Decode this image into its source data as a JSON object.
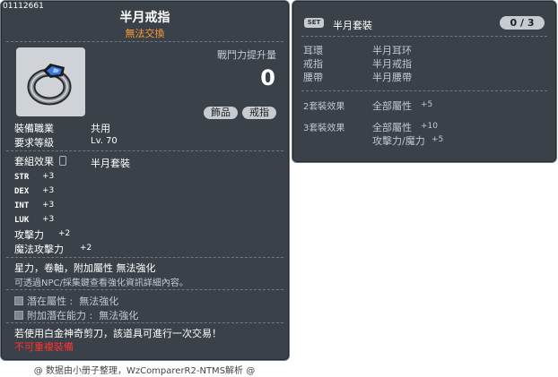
{
  "item_id": "01112661",
  "item": {
    "name": "半月戒指",
    "trade_note": "無法交換",
    "power_label": "戰鬥力提升量",
    "power_value": "0",
    "tags": [
      "飾品",
      "戒指"
    ]
  },
  "requirements": {
    "job_label": "裝備職業",
    "job_value": "共用",
    "level_label": "要求等級",
    "level_value": "Lv. 70"
  },
  "set_effect": {
    "label": "套組效果",
    "name": "半月套裝"
  },
  "stats": [
    {
      "key": "STR",
      "value": "+3"
    },
    {
      "key": "DEX",
      "value": "+3"
    },
    {
      "key": "INT",
      "value": "+3"
    },
    {
      "key": "LUK",
      "value": "+3"
    },
    {
      "key": "攻擊力",
      "value": "+2"
    },
    {
      "key": "魔法攻擊力",
      "value": "+2"
    }
  ],
  "notes": {
    "restrictions": "星力，卷軸，附加屬性 無法強化",
    "npc_hint": "可透過NPC/採集鍵查看強化資訊詳細內容。"
  },
  "potential": {
    "potential_label": "潛在屬性",
    "potential_value": "無法強化",
    "bonus_label": "附加潛在能力",
    "bonus_value": "無法強化"
  },
  "scissors_note": "若使用白金神奇剪刀，該道具可進行一次交易！",
  "unique_note": "不可重複裝備",
  "footer": "@ 数据由小册子整理，WzComparerR2-NTMS解析 @",
  "set_panel": {
    "badge": "SET",
    "title": "半月套裝",
    "count": "0 / 3",
    "parts": [
      {
        "slot": "耳環",
        "name": "半月耳环"
      },
      {
        "slot": "戒指",
        "name": "半月戒指"
      },
      {
        "slot": "腰帶",
        "name": "半月腰帶"
      }
    ],
    "bonus_2_label": "2套裝效果",
    "bonus_2_stat": "全部屬性",
    "bonus_2_value": "+5",
    "bonus_3_label": "3套裝效果",
    "bonus_3_stat": "全部屬性",
    "bonus_3_value": "+10",
    "bonus_3_stat2": "攻擊力/魔力",
    "bonus_3_value2": "+5"
  },
  "colors": {
    "panel_bg": "#3a4149",
    "orange": "#ff9933",
    "red": "#ff3333",
    "label_gray": "#c3c8cf"
  }
}
